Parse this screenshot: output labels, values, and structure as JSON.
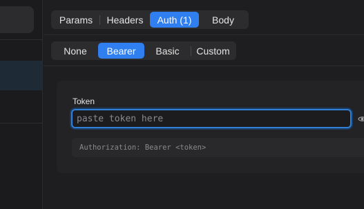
{
  "request_tabs": {
    "items": [
      {
        "label": "Params",
        "active": false
      },
      {
        "label": "Headers",
        "active": false
      },
      {
        "label": "Auth (1)",
        "active": true
      },
      {
        "label": "Body",
        "active": false
      }
    ]
  },
  "auth_types": {
    "items": [
      {
        "label": "None",
        "active": false
      },
      {
        "label": "Bearer",
        "active": true
      },
      {
        "label": "Basic",
        "active": false
      },
      {
        "label": "Custom",
        "active": false
      }
    ]
  },
  "bearer": {
    "token_label": "Token",
    "token_value": "",
    "token_placeholder": "paste token here",
    "header_preview": "Authorization: Bearer <token>",
    "visibility_icon": "eye-icon"
  },
  "colors": {
    "accent": "#2f7ff0",
    "focus_ring": "#2f80d6",
    "background": "#1e1e20",
    "panel": "#232325"
  }
}
